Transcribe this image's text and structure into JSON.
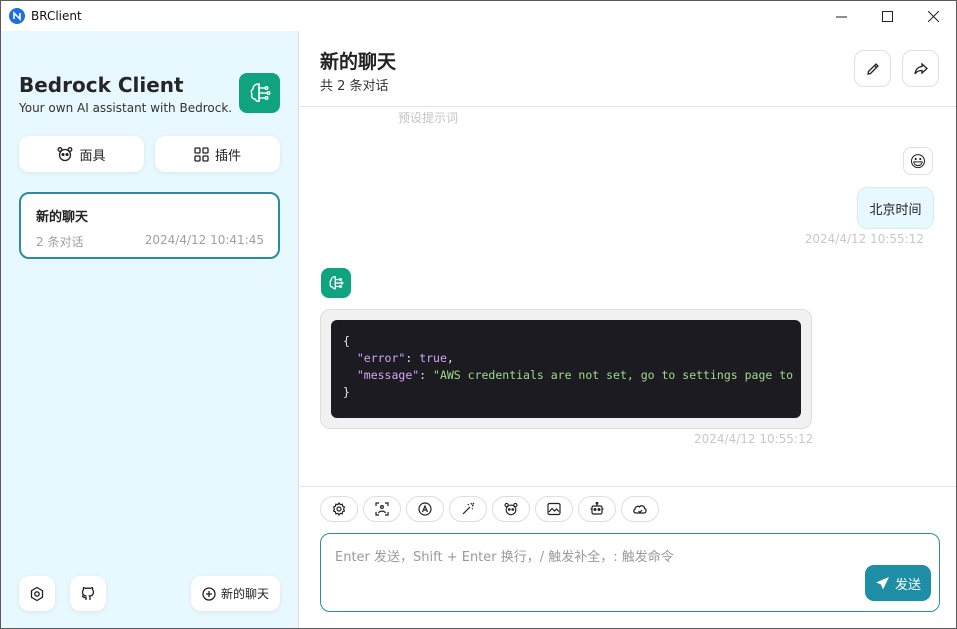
{
  "window": {
    "title": "BRClient"
  },
  "sidebar": {
    "brand_title": "Bedrock Client",
    "brand_subtitle": "Your own AI assistant with Bedrock.",
    "mask_button": "面具",
    "plugin_button": "插件",
    "chats": [
      {
        "title": "新的聊天",
        "count": "2 条对话",
        "time": "2024/4/12 10:41:45"
      }
    ],
    "new_chat_button": "新的聊天"
  },
  "main": {
    "title": "新的聊天",
    "subtitle": "共 2 条对话",
    "faded_hint": "预设提示词",
    "user_message": {
      "avatar": "😃",
      "text": "北京时间",
      "time": "2024/4/12 10:55:12"
    },
    "bot_message": {
      "code_lines": [
        "{",
        "  \"error\": true,",
        "  \"message\": \"AWS credentials are not set, go to settings page to set",
        "}"
      ],
      "key_error": "\"error\"",
      "val_error": "true",
      "key_message": "\"message\"",
      "val_message": "\"AWS credentials are not set, go to settings page to set",
      "time": "2024/4/12 10:55:12"
    }
  },
  "input": {
    "placeholder": "Enter 发送，Shift + Enter 换行，/ 触发补全，: 触发命令",
    "send_label": "发送"
  },
  "colors": {
    "accent": "#2a8d9c",
    "send": "#1d8ea5",
    "brand_green": "#10a37f",
    "sidebar_bg": "#e7f8fe"
  }
}
